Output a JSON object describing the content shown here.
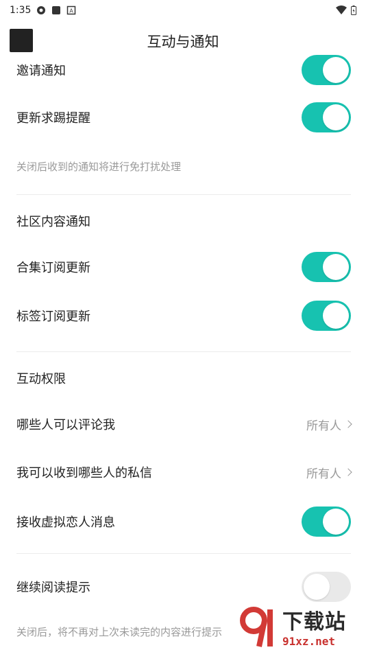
{
  "status_bar": {
    "time": "1:35",
    "icons_left": [
      "sync-icon",
      "square-icon",
      "a-icon"
    ],
    "icons_right": [
      "wifi-icon",
      "battery-icon"
    ]
  },
  "header": {
    "title": "互动与通知",
    "back_icon": "back-icon"
  },
  "rows": {
    "invite": {
      "label": "邀请通知",
      "toggle": true
    },
    "update_request": {
      "label": "更新求踢提醒",
      "toggle": true
    },
    "note1": "关闭后收到的通知将进行免打扰处理",
    "community_section": "社区内容通知",
    "collection": {
      "label": "合集订阅更新",
      "toggle": true
    },
    "tag": {
      "label": "标签订阅更新",
      "toggle": true
    },
    "permission_section": "互动权限",
    "comment": {
      "label": "哪些人可以评论我",
      "value": "所有人"
    },
    "message": {
      "label": "我可以收到哪些人的私信",
      "value": "所有人"
    },
    "virtual": {
      "label": "接收虚拟恋人消息",
      "toggle": true
    },
    "continue_read": {
      "label": "继续阅读提示",
      "toggle": false
    },
    "note2": "关闭后，将不再对上次未读完的内容进行提示"
  },
  "watermark": {
    "main": "下载站",
    "sub": "91xz.net",
    "logo_icon": "91-logo-icon"
  },
  "colors": {
    "toggle_on": "#17c2b0",
    "toggle_off": "#e9e9e9",
    "note_text": "#999999"
  }
}
